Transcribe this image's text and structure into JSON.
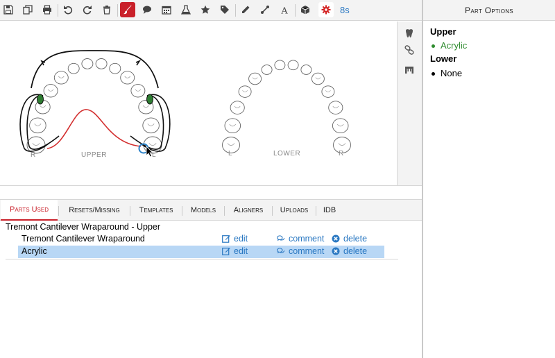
{
  "toolbar": {
    "icons": [
      "save-icon",
      "copy-icon",
      "print-icon",
      "undo-icon",
      "redo-icon",
      "trash-icon",
      "brush-icon",
      "comment-icon",
      "calendar-icon",
      "flask-icon",
      "star-icon",
      "tag-icon",
      "pencil-icon",
      "wrench-icon",
      "text-icon",
      "cube-icon",
      "gear-icon"
    ],
    "timer": "8s",
    "active_color": "#c9202a"
  },
  "chart": {
    "upper_label": "UPPER",
    "lower_label": "LOWER",
    "upper_left_marker": "R",
    "upper_right_marker": "L",
    "lower_left_marker": "L",
    "lower_right_marker": "R",
    "band_color": "#2e7d32",
    "wire_color": "#d32f2f"
  },
  "side_tools": [
    "tooth-icon",
    "link-icon",
    "arch-icon"
  ],
  "right_panel": {
    "title": "Part Options",
    "upper_heading": "Upper",
    "upper_items": [
      "Acrylic"
    ],
    "lower_heading": "Lower",
    "lower_items": [
      "None"
    ],
    "selected_color": "#2e8b2e"
  },
  "tabs": [
    "Parts Used",
    "Resets/Missing",
    "Templates",
    "Models",
    "Aligners",
    "Uploads",
    "IDB"
  ],
  "parts": {
    "group_title": "Tremont Cantilever Wraparound - Upper",
    "rows": [
      {
        "name": "Tremont Cantilever Wraparound",
        "edit": "edit",
        "comment": "comment",
        "delete": "delete"
      },
      {
        "name": "Acrylic",
        "edit": "edit",
        "comment": "comment",
        "delete": "delete"
      }
    ]
  }
}
